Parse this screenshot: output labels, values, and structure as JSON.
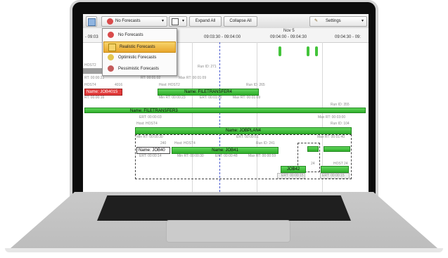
{
  "colors": {
    "bar_green": "#3fbf3a",
    "bar_red": "#e23b3b",
    "menu_highlight": "#f0be4a",
    "now_line": "#4a5bd0"
  },
  "toolbar": {
    "forecast_dropdown": "No Forecasts",
    "expand_all": "Expand All",
    "collapse_all": "Collapse All",
    "settings": "Settings"
  },
  "forecast_menu": {
    "items": [
      {
        "label": "No Forecasts",
        "icon": "no-forecast-icon"
      },
      {
        "label": "Realistic Forecasts",
        "icon": "realistic-forecast-icon",
        "selected": true
      },
      {
        "label": "Optimistic Forecasts",
        "icon": "optimistic-forecast-icon"
      },
      {
        "label": "Pessimistic Forecasts",
        "icon": "pessimistic-forecast-icon"
      }
    ]
  },
  "timeline": {
    "date": "Nov 5",
    "col0": "- 09:03",
    "col1": "09:03:30 - 09:04:00",
    "col2": "09:04:00 - 09:04:30",
    "col3": "09:04:30 - 09:"
  },
  "rows": {
    "host2_a": "HOST2",
    "run271": "Run ID: 271",
    "rt_23": "RT: 00:00:23",
    "rt_01_02": "RT: 00:01:02",
    "max_rt_01_09": "Max RT: 00:01:09",
    "host4_a": "HOST4",
    "num_4016": "4016",
    "host_host2": "Host: HOST2",
    "run265": "Run ID: 265",
    "job4015": "Name: JOB4015",
    "filetransfer4": "Name: FILETRANSFER4",
    "rt_16": "RT: 00:00:16",
    "min_rt_23": "Min RT: 00:00:23",
    "ert_01_02": "ERT: 00:01:02",
    "max_rt_01_09b": "Max RT: 00:01:09",
    "run355": "Run ID: 355",
    "filetransfer3": "Name: FILETRANSFER3",
    "ert_00_03": "ERT: 00:00:03",
    "max_rt_03_00": "Max RT: 00:03:00",
    "host_host4": "Host: HOST4",
    "run104": "Run ID: 104",
    "joblan4": "Name: JOBPLAN4",
    "min_rt_30": "Min RT: 00:00:30",
    "ert_00_51": "ERT: 00:00:51",
    "max_rt_01_40": "Max RT: 00:01:40",
    "n240": "240",
    "host_host4b": "Host: HOST4",
    "run241": "Run ID: 241",
    "job40": "Name: JOB40",
    "job41": "Name: JOB41",
    "ert_14": "ERT: 00:00:14",
    "min_rt_30b": "Min RT: 00:00:30",
    "ert_48": "ERT: 00:00:48",
    "max_rt_59": "Max RT: 00:00:59",
    "job42": "JOB42",
    "ert_15": "ERT: 00:00:15",
    "n24": "24",
    "host_t": "HOST",
    "n24b": "24",
    "ert_15b": "ERT: 00:00:15"
  }
}
